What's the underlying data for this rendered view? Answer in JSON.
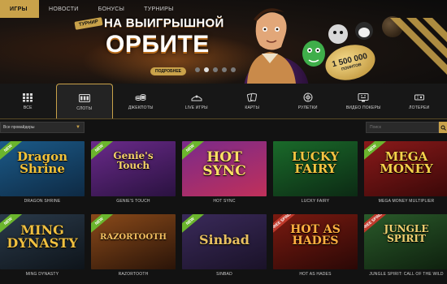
{
  "nav": {
    "tabs": [
      "ИГРЫ",
      "НОВОСТИ",
      "БОНУСЫ",
      "ТУРНИРЫ"
    ]
  },
  "banner": {
    "badge": "ТУРНИР",
    "title_line1": "НА ВЫИГРЫШНОЙ",
    "title_line2": "ОРБИТЕ",
    "more_button": "ПОДРОБНЕЕ",
    "points_value": "1 500 000",
    "points_unit": "ПОИНТОВ",
    "active_slide": 1,
    "slides": 5
  },
  "categories": [
    {
      "label": "ВСЕ",
      "icon": "grid-icon"
    },
    {
      "label": "СЛОТЫ",
      "icon": "slot-reels-icon",
      "active": true
    },
    {
      "label": "ДЖЕКПОТЫ",
      "icon": "coins-icon"
    },
    {
      "label": "LIVE ИГРЫ",
      "icon": "live-table-icon"
    },
    {
      "label": "КАРТЫ",
      "icon": "cards-icon"
    },
    {
      "label": "РУЛЕТКИ",
      "icon": "roulette-icon"
    },
    {
      "label": "ВИДЕО ПОКЕРЫ",
      "icon": "video-poker-icon"
    },
    {
      "label": "ЛОТЕРЕИ",
      "icon": "lottery-icon"
    }
  ],
  "filter": {
    "provider_selected": "Все провайдеры",
    "search_placeholder": "Поиск"
  },
  "games": [
    {
      "title": "DRAGON SHRINE",
      "logo": "Dragon\nShrine",
      "ribbon": "NEW",
      "bg": [
        "#1b5a88",
        "#0e2a44"
      ],
      "logo_color": "#f2c23a"
    },
    {
      "title": "GENIE'S TOUCH",
      "logo": "Genie's\nTouch",
      "ribbon": "NEW",
      "bg": [
        "#6a2a8a",
        "#2a1240"
      ],
      "logo_color": "#f7d36a"
    },
    {
      "title": "HOT SYNC",
      "logo": "HOT\nSYNC",
      "ribbon": "NEW",
      "bg": [
        "#7a2a8a",
        "#c0305a"
      ],
      "logo_color": "#ffe066"
    },
    {
      "title": "LUCKY FAIRY",
      "logo": "LUCKY\nFAIRY",
      "ribbon": "",
      "bg": [
        "#1a6a2a",
        "#0c2a14"
      ],
      "logo_color": "#f5c542"
    },
    {
      "title": "MEGA MONEY MULTIPLIER",
      "logo": "MEGA\nMONEY",
      "ribbon": "NEW",
      "bg": [
        "#8a1a1a",
        "#3a0808"
      ],
      "logo_color": "#f5d14a"
    },
    {
      "title": "MING DYNASTY",
      "logo": "MING\nDYNASTY",
      "ribbon": "NEW",
      "bg": [
        "#2a3a4a",
        "#0e141a"
      ],
      "logo_color": "#f0c040"
    },
    {
      "title": "RAZORTOOTH",
      "logo": "RAZORTOOTH",
      "ribbon": "NEW",
      "bg": [
        "#8a4a1a",
        "#2a1408"
      ],
      "logo_color": "#f4c060"
    },
    {
      "title": "SINBAD",
      "logo": "Sinbad",
      "ribbon": "NEW",
      "bg": [
        "#3a2a5a",
        "#1a1228"
      ],
      "logo_color": "#e8c060"
    },
    {
      "title": "HOT AS HADES",
      "logo": "HOT AS\nHADES",
      "ribbon": "FREE SPINS",
      "bg": [
        "#7a1a10",
        "#2a0806"
      ],
      "logo_color": "#ffb040"
    },
    {
      "title": "JUNGLE SPIRIT: CALL OF THE WILD",
      "logo": "JUNGLE\nSPIRIT",
      "ribbon": "FREE SPINS",
      "bg": [
        "#2a5a2a",
        "#0e200e"
      ],
      "logo_color": "#f0d070"
    }
  ]
}
